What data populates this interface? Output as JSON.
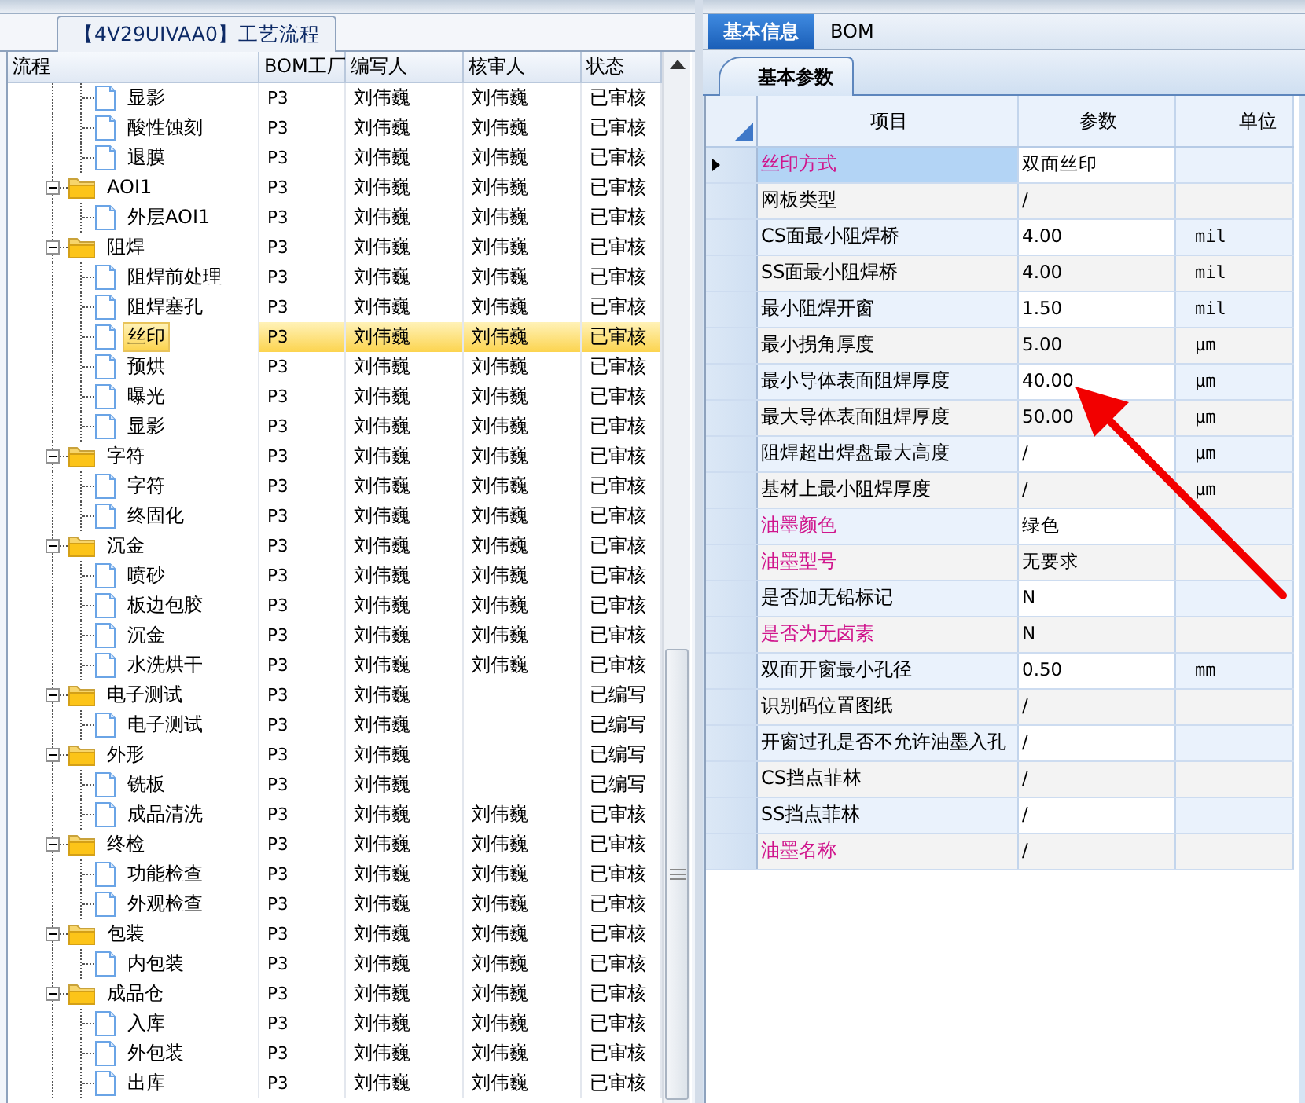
{
  "left_panel": {
    "title": "【4V29UIVAA0】工艺流程"
  },
  "tree": {
    "columns": [
      "流程",
      "BOM工厂",
      "编写人",
      "核审人",
      "状态"
    ],
    "rows": [
      {
        "kind": "continued",
        "children": [
          {
            "kind": "file",
            "label": "显影",
            "bom": "P3",
            "author": "刘伟巍",
            "reviewer": "刘伟巍",
            "status": "已审核",
            "selected": false
          },
          {
            "kind": "file",
            "label": "酸性蚀刻",
            "bom": "P3",
            "author": "刘伟巍",
            "reviewer": "刘伟巍",
            "status": "已审核",
            "selected": false
          },
          {
            "kind": "file",
            "label": "退膜",
            "bom": "P3",
            "author": "刘伟巍",
            "reviewer": "刘伟巍",
            "status": "已审核",
            "selected": false
          }
        ]
      },
      {
        "kind": "folder",
        "label": "AOI1",
        "bom": "P3",
        "author": "刘伟巍",
        "reviewer": "刘伟巍",
        "status": "已审核",
        "selected": false,
        "expanded": true,
        "children": [
          {
            "kind": "file",
            "label": "外层AOI1",
            "bom": "P3",
            "author": "刘伟巍",
            "reviewer": "刘伟巍",
            "status": "已审核",
            "selected": false
          }
        ]
      },
      {
        "kind": "folder",
        "label": "阻焊",
        "bom": "P3",
        "author": "刘伟巍",
        "reviewer": "刘伟巍",
        "status": "已审核",
        "selected": false,
        "expanded": true,
        "children": [
          {
            "kind": "file",
            "label": "阻焊前处理",
            "bom": "P3",
            "author": "刘伟巍",
            "reviewer": "刘伟巍",
            "status": "已审核",
            "selected": false
          },
          {
            "kind": "file",
            "label": "阻焊塞孔",
            "bom": "P3",
            "author": "刘伟巍",
            "reviewer": "刘伟巍",
            "status": "已审核",
            "selected": false
          },
          {
            "kind": "file",
            "label": "丝印",
            "bom": "P3",
            "author": "刘伟巍",
            "reviewer": "刘伟巍",
            "status": "已审核",
            "selected": true
          },
          {
            "kind": "file",
            "label": "预烘",
            "bom": "P3",
            "author": "刘伟巍",
            "reviewer": "刘伟巍",
            "status": "已审核",
            "selected": false
          },
          {
            "kind": "file",
            "label": "曝光",
            "bom": "P3",
            "author": "刘伟巍",
            "reviewer": "刘伟巍",
            "status": "已审核",
            "selected": false
          },
          {
            "kind": "file",
            "label": "显影",
            "bom": "P3",
            "author": "刘伟巍",
            "reviewer": "刘伟巍",
            "status": "已审核",
            "selected": false
          }
        ]
      },
      {
        "kind": "folder",
        "label": "字符",
        "bom": "P3",
        "author": "刘伟巍",
        "reviewer": "刘伟巍",
        "status": "已审核",
        "selected": false,
        "expanded": true,
        "children": [
          {
            "kind": "file",
            "label": "字符",
            "bom": "P3",
            "author": "刘伟巍",
            "reviewer": "刘伟巍",
            "status": "已审核",
            "selected": false
          },
          {
            "kind": "file",
            "label": "终固化",
            "bom": "P3",
            "author": "刘伟巍",
            "reviewer": "刘伟巍",
            "status": "已审核",
            "selected": false
          }
        ]
      },
      {
        "kind": "folder",
        "label": "沉金",
        "bom": "P3",
        "author": "刘伟巍",
        "reviewer": "刘伟巍",
        "status": "已审核",
        "selected": false,
        "expanded": true,
        "children": [
          {
            "kind": "file",
            "label": "喷砂",
            "bom": "P3",
            "author": "刘伟巍",
            "reviewer": "刘伟巍",
            "status": "已审核",
            "selected": false
          },
          {
            "kind": "file",
            "label": "板边包胶",
            "bom": "P3",
            "author": "刘伟巍",
            "reviewer": "刘伟巍",
            "status": "已审核",
            "selected": false
          },
          {
            "kind": "file",
            "label": "沉金",
            "bom": "P3",
            "author": "刘伟巍",
            "reviewer": "刘伟巍",
            "status": "已审核",
            "selected": false
          },
          {
            "kind": "file",
            "label": "水洗烘干",
            "bom": "P3",
            "author": "刘伟巍",
            "reviewer": "刘伟巍",
            "status": "已审核",
            "selected": false
          }
        ]
      },
      {
        "kind": "folder",
        "label": "电子测试",
        "bom": "P3",
        "author": "刘伟巍",
        "status": "已编写",
        "selected": false,
        "expanded": true,
        "children": [
          {
            "kind": "file",
            "label": "电子测试",
            "bom": "P3",
            "author": "刘伟巍",
            "status": "已编写",
            "selected": false
          }
        ]
      },
      {
        "kind": "folder",
        "label": "外形",
        "bom": "P3",
        "author": "刘伟巍",
        "status": "已编写",
        "selected": false,
        "expanded": true,
        "children": [
          {
            "kind": "file",
            "label": "铣板",
            "bom": "P3",
            "author": "刘伟巍",
            "status": "已编写",
            "selected": false
          },
          {
            "kind": "file",
            "label": "成品清洗",
            "bom": "P3",
            "author": "刘伟巍",
            "reviewer": "刘伟巍",
            "status": "已审核",
            "selected": false
          }
        ]
      },
      {
        "kind": "folder",
        "label": "终检",
        "bom": "P3",
        "author": "刘伟巍",
        "reviewer": "刘伟巍",
        "status": "已审核",
        "selected": false,
        "expanded": true,
        "children": [
          {
            "kind": "file",
            "label": "功能检查",
            "bom": "P3",
            "author": "刘伟巍",
            "reviewer": "刘伟巍",
            "status": "已审核",
            "selected": false
          },
          {
            "kind": "file",
            "label": "外观检查",
            "bom": "P3",
            "author": "刘伟巍",
            "reviewer": "刘伟巍",
            "status": "已审核",
            "selected": false
          }
        ]
      },
      {
        "kind": "folder",
        "label": "包装",
        "bom": "P3",
        "author": "刘伟巍",
        "reviewer": "刘伟巍",
        "status": "已审核",
        "selected": false,
        "expanded": true,
        "children": [
          {
            "kind": "file",
            "label": "内包装",
            "bom": "P3",
            "author": "刘伟巍",
            "reviewer": "刘伟巍",
            "status": "已审核",
            "selected": false
          }
        ]
      },
      {
        "kind": "folder",
        "label": "成品仓",
        "bom": "P3",
        "author": "刘伟巍",
        "reviewer": "刘伟巍",
        "status": "已审核",
        "selected": false,
        "expanded": true,
        "children": [
          {
            "kind": "file",
            "label": "入库",
            "bom": "P3",
            "author": "刘伟巍",
            "reviewer": "刘伟巍",
            "status": "已审核",
            "selected": false
          },
          {
            "kind": "file",
            "label": "外包装",
            "bom": "P3",
            "author": "刘伟巍",
            "reviewer": "刘伟巍",
            "status": "已审核",
            "selected": false
          },
          {
            "kind": "file",
            "label": "出库",
            "bom": "P3",
            "author": "刘伟巍",
            "reviewer": "刘伟巍",
            "status": "已审核",
            "selected": false
          }
        ]
      }
    ]
  },
  "tabs": [
    {
      "label": "基本信息",
      "selected": true
    },
    {
      "label": "BOM",
      "selected": false
    }
  ],
  "subtab": {
    "label": "基本参数"
  },
  "grid": {
    "columns": [
      "项目",
      "参数",
      "单位"
    ],
    "rows": [
      {
        "item": "丝印方式",
        "value": "双面丝印",
        "highlight": true,
        "current": true
      },
      {
        "item": "网板类型",
        "value": "/",
        "highlight": false,
        "current": false
      },
      {
        "item": "CS面最小阻焊桥",
        "value": "4.00",
        "unit": "mil",
        "highlight": false,
        "current": false
      },
      {
        "item": "SS面最小阻焊桥",
        "value": "4.00",
        "unit": "mil",
        "highlight": false,
        "current": false
      },
      {
        "item": "最小阻焊开窗",
        "value": "1.50",
        "unit": "mil",
        "highlight": false,
        "current": false
      },
      {
        "item": "最小拐角厚度",
        "value": "5.00",
        "unit": "μm",
        "highlight": false,
        "current": false
      },
      {
        "item": "最小导体表面阻焊厚度",
        "value": "40.00",
        "unit": "μm",
        "highlight": false,
        "current": false
      },
      {
        "item": "最大导体表面阻焊厚度",
        "value": "50.00",
        "unit": "μm",
        "highlight": false,
        "current": false
      },
      {
        "item": "阻焊超出焊盘最大高度",
        "value": "/",
        "unit": "μm",
        "highlight": false,
        "current": false
      },
      {
        "item": "基材上最小阻焊厚度",
        "value": "/",
        "unit": "μm",
        "highlight": false,
        "current": false
      },
      {
        "item": "油墨颜色",
        "value": "绿色",
        "highlight": true,
        "current": false
      },
      {
        "item": "油墨型号",
        "value": "无要求",
        "highlight": true,
        "current": false
      },
      {
        "item": "是否加无铅标记",
        "value": "N",
        "highlight": false,
        "current": false
      },
      {
        "item": "是否为无卤素",
        "value": "N",
        "highlight": true,
        "current": false
      },
      {
        "item": "双面开窗最小孔径",
        "value": "0.50",
        "unit": "mm",
        "highlight": false,
        "current": false
      },
      {
        "item": "识别码位置图纸",
        "value": "/",
        "highlight": false,
        "current": false
      },
      {
        "item": "开窗过孔是否不允许油墨入孔",
        "value": "/",
        "highlight": false,
        "current": false
      },
      {
        "item": "CS挡点菲林",
        "value": "/",
        "highlight": false,
        "current": false
      },
      {
        "item": "SS挡点菲林",
        "value": "/",
        "highlight": false,
        "current": false
      },
      {
        "item": "油墨名称",
        "value": "/",
        "highlight": true,
        "current": false
      }
    ]
  }
}
